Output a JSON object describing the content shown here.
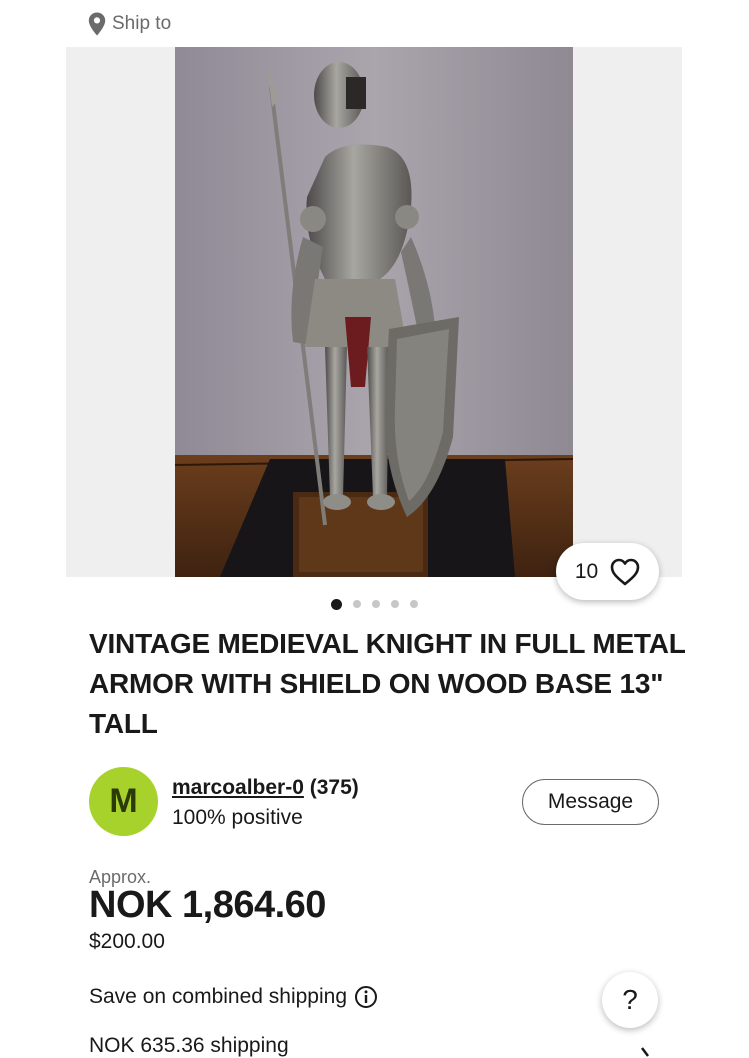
{
  "header": {
    "ship_to_label": "Ship to"
  },
  "gallery": {
    "image_count": 5,
    "active_index": 0
  },
  "watch": {
    "count": "10"
  },
  "listing": {
    "title": "VINTAGE MEDIEVAL KNIGHT IN FULL METAL ARMOR WITH SHIELD ON WOOD BASE 13\" TALL"
  },
  "seller": {
    "initial": "M",
    "name": "marcoalber-0",
    "feedback_count": "(375)",
    "positive": "100% positive",
    "avatar_color": "#a6d22b"
  },
  "actions": {
    "message_label": "Message",
    "help_label": "?"
  },
  "price": {
    "approx_label": "Approx.",
    "converted": "NOK 1,864.60",
    "original": "$200.00"
  },
  "shipping": {
    "combined_label": "Save on combined shipping",
    "cost": "NOK 635.36 shipping"
  }
}
